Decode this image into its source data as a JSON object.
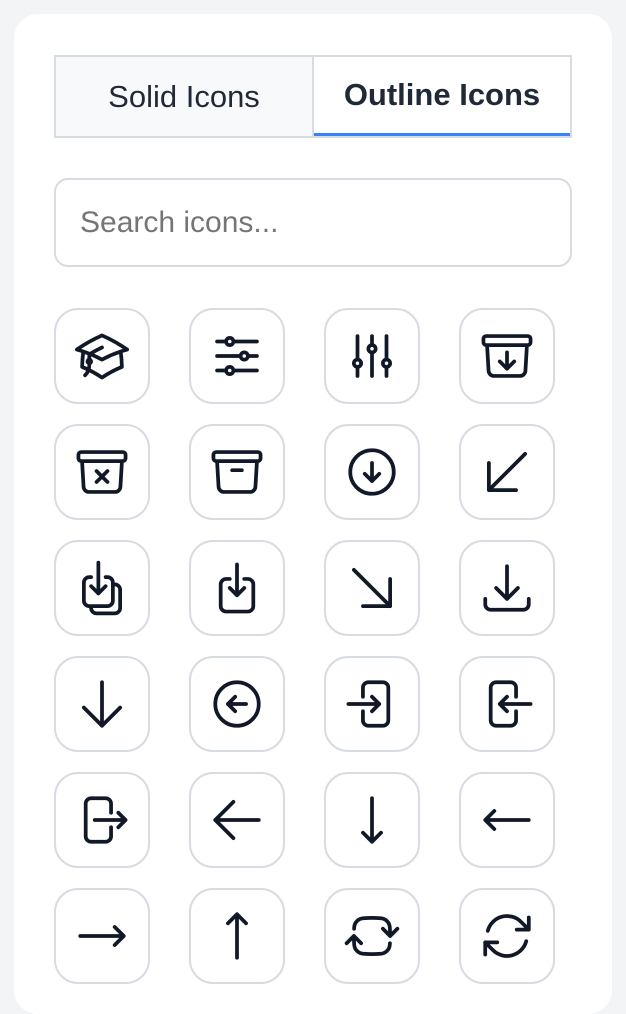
{
  "tabs": {
    "solid_label": "Solid Icons",
    "outline_label": "Outline Icons",
    "active_tab": "Outline Icons"
  },
  "search": {
    "placeholder": "Search icons...",
    "value": ""
  },
  "icons": [
    "academic-cap-icon",
    "adjustments-horizontal-icon",
    "adjustments-vertical-icon",
    "archive-box-arrow-down-icon",
    "archive-box-x-mark-icon",
    "archive-box-icon",
    "arrow-down-circle-icon",
    "arrow-down-left-icon",
    "arrow-down-on-square-stack-icon",
    "arrow-down-on-square-icon",
    "arrow-down-right-icon",
    "arrow-down-tray-icon",
    "arrow-down-icon",
    "arrow-left-circle-icon",
    "arrow-left-end-on-rectangle-icon",
    "arrow-left-on-rectangle-icon",
    "arrow-left-start-on-rectangle-icon",
    "arrow-left-icon",
    "arrow-long-down-icon",
    "arrow-long-left-icon",
    "arrow-long-right-icon",
    "arrow-long-up-icon",
    "arrow-path-rounded-square-icon",
    "arrow-path-icon"
  ],
  "colors": {
    "accent": "#3b82f6",
    "icon_stroke": "#111827",
    "border": "#d7dbe2",
    "text": "#1f2937",
    "placeholder": "#757575",
    "page_bg": "#f3f4f6"
  }
}
